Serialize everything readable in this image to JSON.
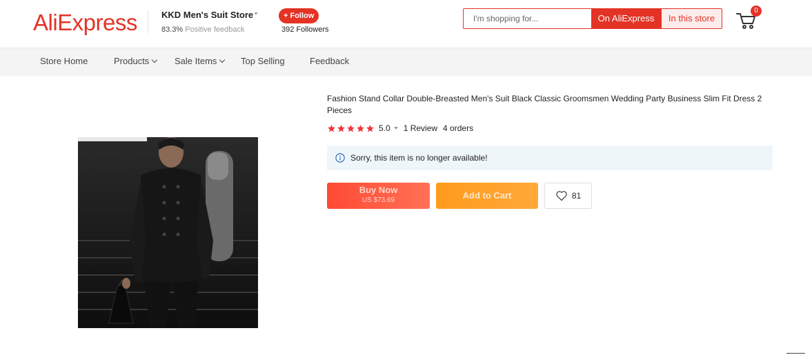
{
  "header": {
    "logo": "AliExpress",
    "store_name": "KKD Men's Suit Store",
    "feedback_pct": "83.3%",
    "feedback_label": "Positive feedback",
    "follow_label": "+ Follow",
    "followers": "392 Followers",
    "search_placeholder": "I'm shopping for...",
    "search_ali_label": "On AliExpress",
    "search_store_label": "In this store",
    "cart_count": "0",
    "brand_color": "#e43225"
  },
  "nav": {
    "items": [
      {
        "label": "Store Home",
        "icon": ""
      },
      {
        "label": "Products",
        "icon": "chevron-down-icon"
      },
      {
        "label": "Sale Items",
        "icon": "chevron-down-icon"
      },
      {
        "label": "Top Selling",
        "icon": ""
      },
      {
        "label": "Feedback",
        "icon": ""
      }
    ]
  },
  "product": {
    "title": "Fashion Stand Collar Double-Breasted Men's Suit Black Classic Groomsmen Wedding Party Business Slim Fit Dress 2 Pieces",
    "rating_stars": 5,
    "rating": "5.0",
    "reviews": "1 Review",
    "orders": "4 orders",
    "notice": "Sorry, this item is no longer available!",
    "buy_label": "Buy Now",
    "buy_price": "US $73.69",
    "cart_label": "Add to Cart",
    "wishlist_count": "81"
  }
}
